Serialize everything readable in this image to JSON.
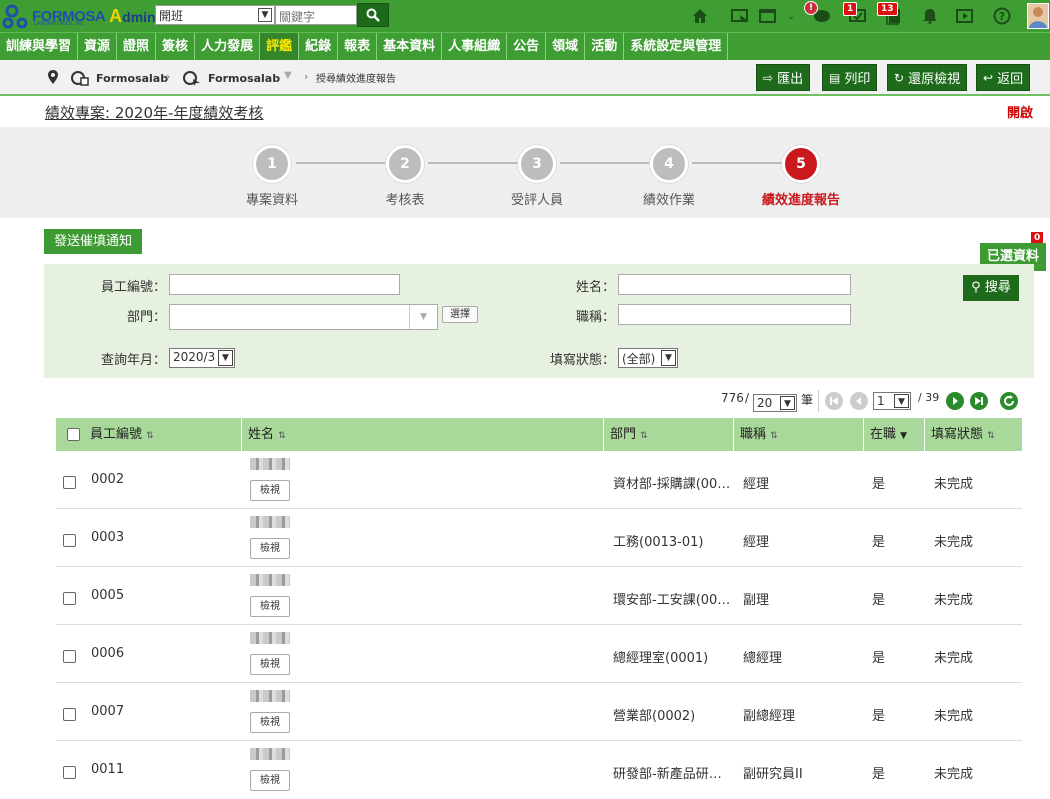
{
  "topbar": {
    "logo_word": "FORMOSA",
    "logo_sub": "LABORATORIES, INC.",
    "logo_admin_a": "A",
    "logo_admin_rest": "dmin",
    "unit_select_value": "開班",
    "keyword_placeholder": "關鍵字",
    "notification_badges": [
      "!",
      "1",
      "13"
    ]
  },
  "menu": [
    "訓練與學習",
    "資源",
    "證照",
    "簽核",
    "人力發展",
    "評鑑",
    "紀錄",
    "報表",
    "基本資料",
    "人事組織",
    "公告",
    "領域",
    "活動",
    "系統設定與管理"
  ],
  "menu_active_index": 5,
  "breadcrumb": {
    "item1": "Formosalab",
    "item2": "Formosalab",
    "item3": "授尋績效進度報告"
  },
  "actions": {
    "export": "匯出",
    "print": "列印",
    "reset": "還原檢視",
    "back": "返回"
  },
  "project_title": "績效專案: 2020年-年度績效考核",
  "open_label": "開啟",
  "steps": [
    {
      "num": "1",
      "label": "專案資料"
    },
    {
      "num": "2",
      "label": "考核表"
    },
    {
      "num": "3",
      "label": "受評人員"
    },
    {
      "num": "4",
      "label": "績效作業"
    },
    {
      "num": "5",
      "label": "績效進度報告"
    }
  ],
  "notify_button": "發送催填通知",
  "selected_button": "已選資料",
  "selected_count": "0",
  "search": {
    "emp_no_label": "員工編號：",
    "name_label": "姓名：",
    "dept_label": "部門：",
    "choose_button": "選擇",
    "title_label": "職稱：",
    "month_label": "查詢年月：",
    "month_value": "2020/3",
    "status_label": "填寫狀態：",
    "status_value": "(全部)",
    "search_button": "搜尋"
  },
  "pager": {
    "total": "776",
    "slash1": "/",
    "page_size": "20",
    "unit": "筆",
    "page": "1",
    "total_pages": "/ 39"
  },
  "table": {
    "headers": [
      "員工編號",
      "姓名",
      "部門",
      "職稱",
      "在職",
      "填寫狀態"
    ],
    "view_label": "檢視",
    "rows": [
      {
        "emp_no": "0002",
        "dept": "資材部-採購課(00…",
        "title": "經理",
        "active": "是",
        "status": "未完成"
      },
      {
        "emp_no": "0003",
        "dept": "工務(0013-01)",
        "title": "經理",
        "active": "是",
        "status": "未完成"
      },
      {
        "emp_no": "0005",
        "dept": "環安部-工安課(00…",
        "title": "副理",
        "active": "是",
        "status": "未完成"
      },
      {
        "emp_no": "0006",
        "dept": "總經理室(0001)",
        "title": "總經理",
        "active": "是",
        "status": "未完成"
      },
      {
        "emp_no": "0007",
        "dept": "營業部(0002)",
        "title": "副總經理",
        "active": "是",
        "status": "未完成"
      },
      {
        "emp_no": "0011",
        "dept": "研發部-新產品研…",
        "title": "副研究員II",
        "active": "是",
        "status": "未完成"
      }
    ]
  },
  "colors": {
    "brand_green": "#3f9e33",
    "dark_green": "#1f6b1c",
    "active_step": "#c9191c",
    "menu_active_text": "#f7e600",
    "table_header": "#a9d89b"
  }
}
